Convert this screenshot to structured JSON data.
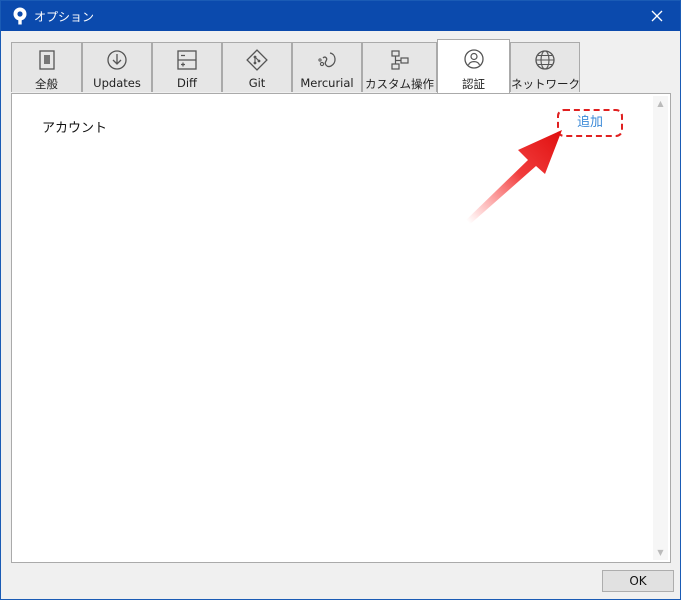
{
  "window": {
    "title": "オプション"
  },
  "tabs": [
    {
      "id": "general",
      "label": "全般",
      "icon": "toggle-icon"
    },
    {
      "id": "updates",
      "label": "Updates",
      "icon": "download-icon"
    },
    {
      "id": "diff",
      "label": "Diff",
      "icon": "diff-icon"
    },
    {
      "id": "git",
      "label": "Git",
      "icon": "git-icon"
    },
    {
      "id": "mercurial",
      "label": "Mercurial",
      "icon": "mercurial-icon"
    },
    {
      "id": "custom",
      "label": "カスタム操作",
      "icon": "custom-actions-icon"
    },
    {
      "id": "auth",
      "label": "認証",
      "icon": "user-icon",
      "active": true
    },
    {
      "id": "network",
      "label": "ネットワーク",
      "icon": "globe-icon"
    }
  ],
  "auth": {
    "account_label": "アカウント",
    "add_label": "追加"
  },
  "footer": {
    "ok_label": "OK"
  },
  "colors": {
    "titlebar": "#0b4aad",
    "link": "#3c8ad8",
    "highlight": "#e02020"
  }
}
